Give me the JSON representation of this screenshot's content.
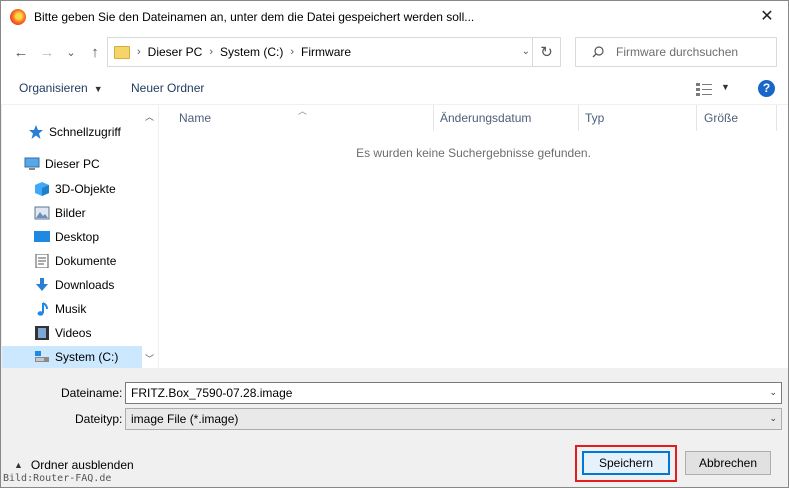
{
  "window": {
    "title": "Bitte geben Sie den Dateinamen an, unter dem die Datei gespeichert werden soll...",
    "close_symbol": "✕"
  },
  "nav": {
    "back_symbol": "←",
    "forward_symbol": "→",
    "recent_symbol": "⌄",
    "up_symbol": "↑",
    "breadcrumbs": [
      "Dieser PC",
      "System (C:)",
      "Firmware"
    ],
    "refresh_symbol": "↻",
    "search_placeholder": "Firmware durchsuchen"
  },
  "toolbar": {
    "organize_label": "Organisieren",
    "new_folder_label": "Neuer Ordner",
    "help_label": "?"
  },
  "sidebar": {
    "items": [
      {
        "label": "Schnellzugriff",
        "icon": "star-icon"
      },
      {
        "label": "Dieser PC",
        "icon": "computer-icon"
      },
      {
        "label": "3D-Objekte",
        "icon": "cube-icon"
      },
      {
        "label": "Bilder",
        "icon": "pictures-icon"
      },
      {
        "label": "Desktop",
        "icon": "desktop-icon"
      },
      {
        "label": "Dokumente",
        "icon": "documents-icon"
      },
      {
        "label": "Downloads",
        "icon": "download-icon"
      },
      {
        "label": "Musik",
        "icon": "music-icon"
      },
      {
        "label": "Videos",
        "icon": "video-icon"
      },
      {
        "label": "System (C:)",
        "icon": "drive-icon",
        "selected": true
      }
    ]
  },
  "file_list": {
    "columns": [
      "Name",
      "Änderungsdatum",
      "Typ",
      "Größe"
    ],
    "empty_message": "Es wurden keine Suchergebnisse gefunden."
  },
  "form": {
    "filename_label": "Dateiname:",
    "filename_value": "FRITZ.Box_7590-07.28.image",
    "filetype_label": "Dateityp:",
    "filetype_value": "image File (*.image)"
  },
  "footer": {
    "hide_folders_label": "Ordner ausblenden",
    "save_label": "Speichern",
    "cancel_label": "Abbrechen"
  },
  "watermark": "Bild:Router-FAQ.de",
  "colors": {
    "accent": "#0078d7",
    "highlight_box": "#e01e1e",
    "selected_item": "#cce8ff",
    "help_icon": "#1a66c8"
  }
}
